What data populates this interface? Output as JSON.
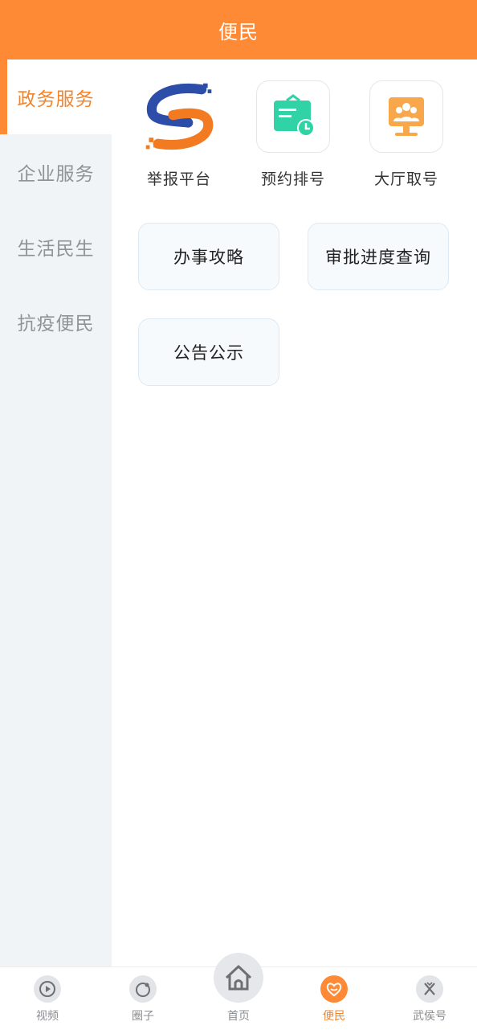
{
  "header": {
    "title": "便民"
  },
  "sidebar": {
    "items": [
      {
        "label": "政务服务",
        "active": true
      },
      {
        "label": "企业服务",
        "active": false
      },
      {
        "label": "生活民生",
        "active": false
      },
      {
        "label": "抗疫便民",
        "active": false
      }
    ]
  },
  "services": {
    "icons": [
      {
        "label": "举报平台",
        "icon": "report-logo-icon"
      },
      {
        "label": "预约排号",
        "icon": "calendar-clock-icon"
      },
      {
        "label": "大厅取号",
        "icon": "hall-queue-icon"
      }
    ],
    "buttons": [
      {
        "label": "办事攻略"
      },
      {
        "label": "审批进度查询"
      },
      {
        "label": "公告公示"
      }
    ]
  },
  "tabbar": {
    "items": [
      {
        "label": "视频",
        "icon": "video-play-icon"
      },
      {
        "label": "圈子",
        "icon": "circle-icon"
      },
      {
        "label": "首页",
        "icon": "home-icon"
      },
      {
        "label": "便民",
        "icon": "heart-icon",
        "active": true
      },
      {
        "label": "武侯号",
        "icon": "wuhou-icon"
      }
    ]
  },
  "colors": {
    "accent": "#FF8A35",
    "sidebar_bg": "#F0F4F7",
    "active_text": "#F0842F"
  }
}
